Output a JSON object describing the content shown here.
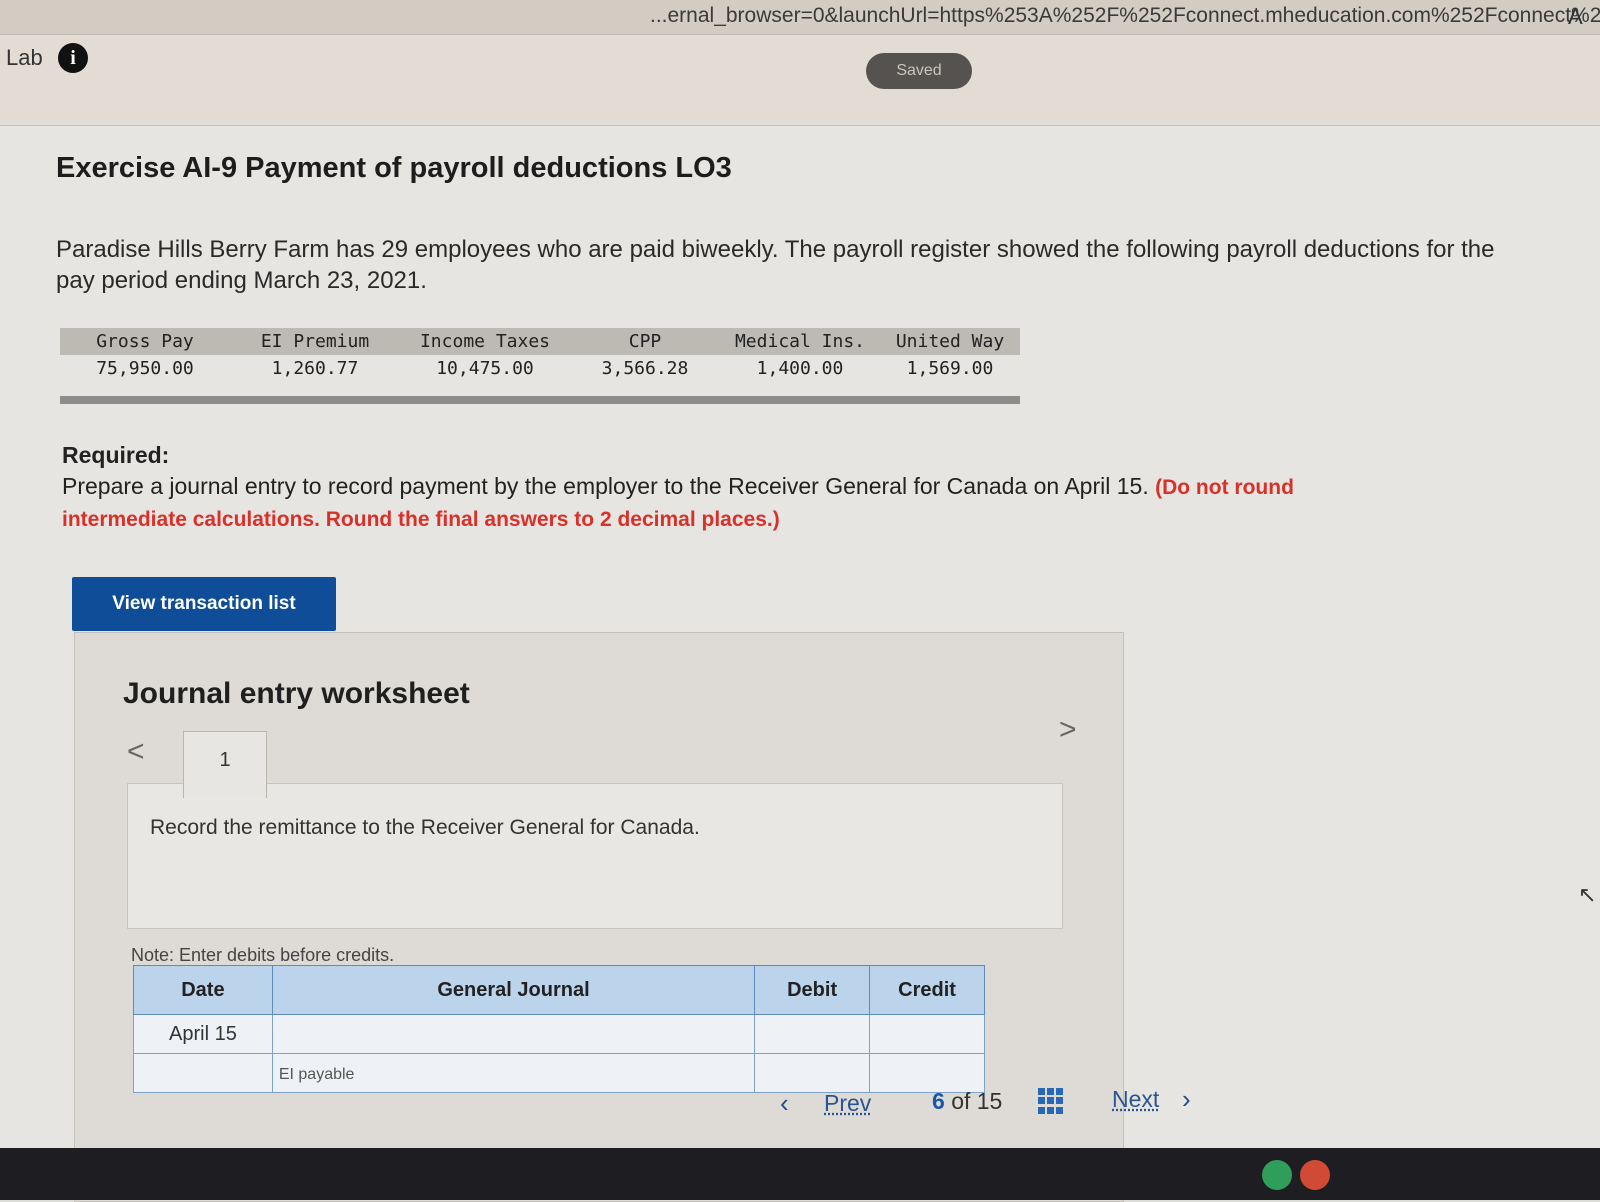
{
  "browser": {
    "url_text": "...ernal_browser=0&launchUrl=https%253A%252F%252Fconnect.mheducation.com%252Fconnect%2...",
    "reader_icon": "A"
  },
  "header": {
    "lab_label": "Lab",
    "info_icon": "i",
    "saved_label": "Saved"
  },
  "exercise": {
    "title": "Exercise AI-9 Payment of payroll deductions LO3",
    "intro": "Paradise Hills Berry Farm has 29 employees who are paid biweekly. The payroll register showed the following payroll deductions for the pay period ending March 23, 2021."
  },
  "deductions": {
    "headers": [
      "Gross Pay",
      "EI Premium",
      "Income Taxes",
      "CPP",
      "Medical Ins.",
      "United Way"
    ],
    "values": [
      "75,950.00",
      "1,260.77",
      "10,475.00",
      "3,566.28",
      "1,400.00",
      "1,569.00"
    ]
  },
  "required": {
    "label": "Required:",
    "text": "Prepare a journal entry to record payment by the employer to the Receiver General for Canada on April 15.",
    "note": "(Do not round intermediate calculations. Round the final answers to 2 decimal places.)"
  },
  "view_button": "View transaction list",
  "worksheet": {
    "title": "Journal entry worksheet",
    "nav_prev": "<",
    "nav_next": ">",
    "tab_label": "1",
    "task_text": "Record the remittance to the Receiver General for Canada.",
    "note": "Note: Enter debits before credits.",
    "table": {
      "headers": {
        "date": "Date",
        "journal": "General Journal",
        "debit": "Debit",
        "credit": "Credit"
      },
      "rows": [
        {
          "date": "April 15",
          "account": "",
          "debit": "",
          "credit": ""
        },
        {
          "date": "",
          "account": "EI payable",
          "debit": "",
          "credit": ""
        }
      ]
    }
  },
  "pager": {
    "prev": "Prev",
    "current": "6",
    "of": "of",
    "total": "15",
    "next": "Next"
  }
}
